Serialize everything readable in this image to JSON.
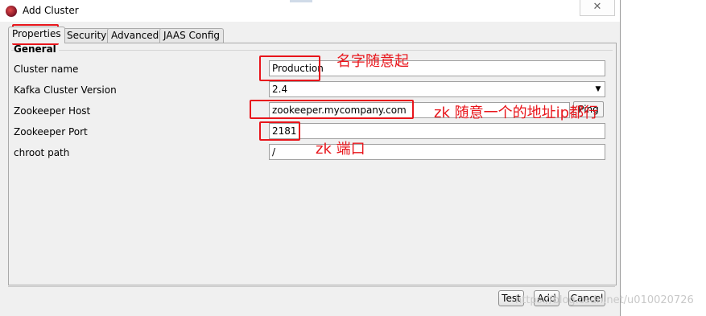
{
  "window": {
    "title": "Add Cluster",
    "close_glyph": "✕",
    "icon": "app-icon"
  },
  "tabs": [
    {
      "label": "Properties",
      "active": true
    },
    {
      "label": "Security"
    },
    {
      "label": "Advanced"
    },
    {
      "label": "JAAS Config"
    }
  ],
  "group": {
    "title": "General"
  },
  "fields": {
    "cluster_name": {
      "label": "Cluster name",
      "value": "Production"
    },
    "kafka_version": {
      "label": "Kafka Cluster Version",
      "value": "2.4",
      "arrow": "▼"
    },
    "zookeeper_host": {
      "label": "Zookeeper Host",
      "value": "zookeeper.mycompany.com",
      "ping_label": "Ping"
    },
    "zookeeper_port": {
      "label": "Zookeeper Port",
      "value": "2181"
    },
    "chroot_path": {
      "label": "chroot path",
      "value": "/"
    }
  },
  "buttons": {
    "test": "Test",
    "add": "Add",
    "cancel": "Cancel"
  },
  "annotations": {
    "name_note": "名字随意起",
    "host_note": "zk 随意一个的地址ip都行",
    "port_note": "zk 端口",
    "color": "#e8151b"
  },
  "watermark": "https://blog.csdn.net/u010020726"
}
